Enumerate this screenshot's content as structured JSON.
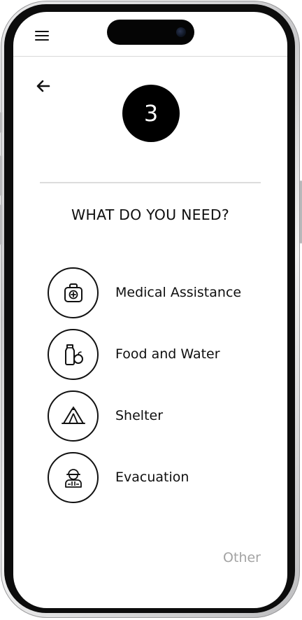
{
  "step": {
    "number": "3"
  },
  "question": "WHAT DO YOU NEED?",
  "options": [
    {
      "label": "Medical Assistance",
      "icon": "medical-kit-icon"
    },
    {
      "label": "Food and Water",
      "icon": "food-water-icon"
    },
    {
      "label": "Shelter",
      "icon": "tent-icon"
    },
    {
      "label": "Evacuation",
      "icon": "rescuer-icon"
    }
  ],
  "other_label": "Other",
  "icons": {
    "menu": "hamburger-menu-icon",
    "back": "back-arrow-icon"
  },
  "colors": {
    "primary": "#000000",
    "muted_text": "#a3a3a3",
    "divider": "#dcdcdc"
  }
}
